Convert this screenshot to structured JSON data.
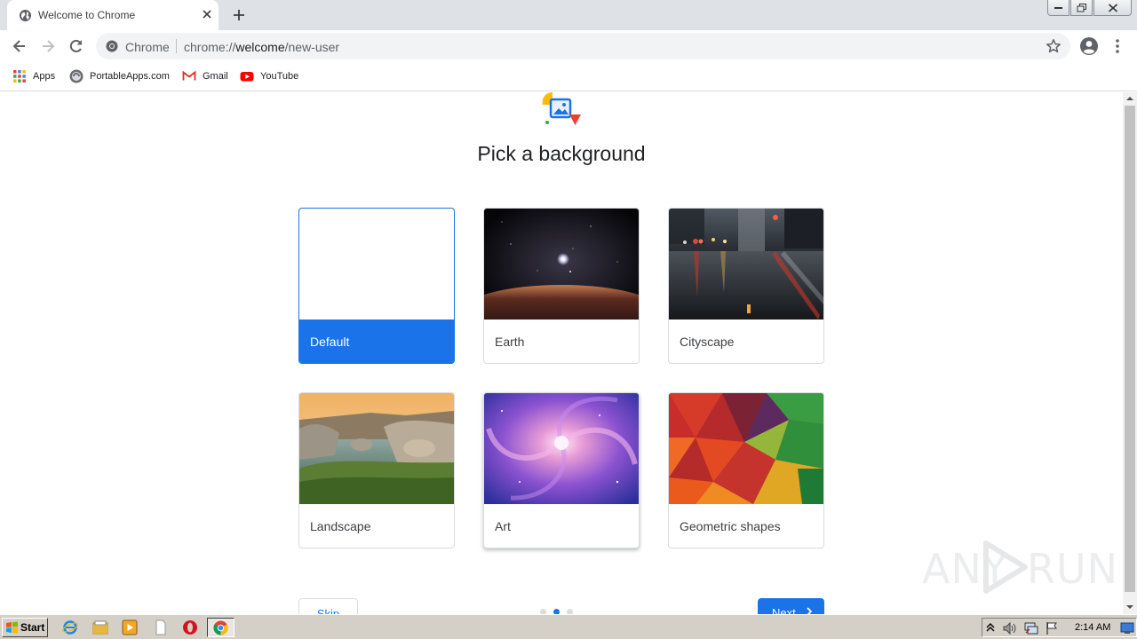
{
  "tab": {
    "title": "Welcome to Chrome"
  },
  "omnibox": {
    "scheme_label": "Chrome",
    "url_prefix": "chrome://",
    "url_host": "welcome",
    "url_path": "/new-user"
  },
  "bookmarks": [
    {
      "label": "Apps",
      "icon": "apps-grid-icon"
    },
    {
      "label": "PortableApps.com",
      "icon": "portableapps-icon"
    },
    {
      "label": "Gmail",
      "icon": "gmail-icon"
    },
    {
      "label": "YouTube",
      "icon": "youtube-icon"
    }
  ],
  "page": {
    "title": "Pick a background",
    "options": [
      {
        "label": "Default",
        "selected": true
      },
      {
        "label": "Earth",
        "selected": false
      },
      {
        "label": "Cityscape",
        "selected": false
      },
      {
        "label": "Landscape",
        "selected": false
      },
      {
        "label": "Art",
        "selected": false
      },
      {
        "label": "Geometric shapes",
        "selected": false
      }
    ],
    "skip_label": "Skip",
    "next_label": "Next",
    "progress": {
      "steps": 3,
      "current": 2
    }
  },
  "watermark": {
    "left": "ANY",
    "right": "RUN"
  },
  "taskbar": {
    "start_label": "Start",
    "clock": "2:14 AM"
  },
  "colors": {
    "accent": "#1a73e8",
    "tabstrip": "#dee1e6",
    "taskbar": "#d4d0c8"
  }
}
